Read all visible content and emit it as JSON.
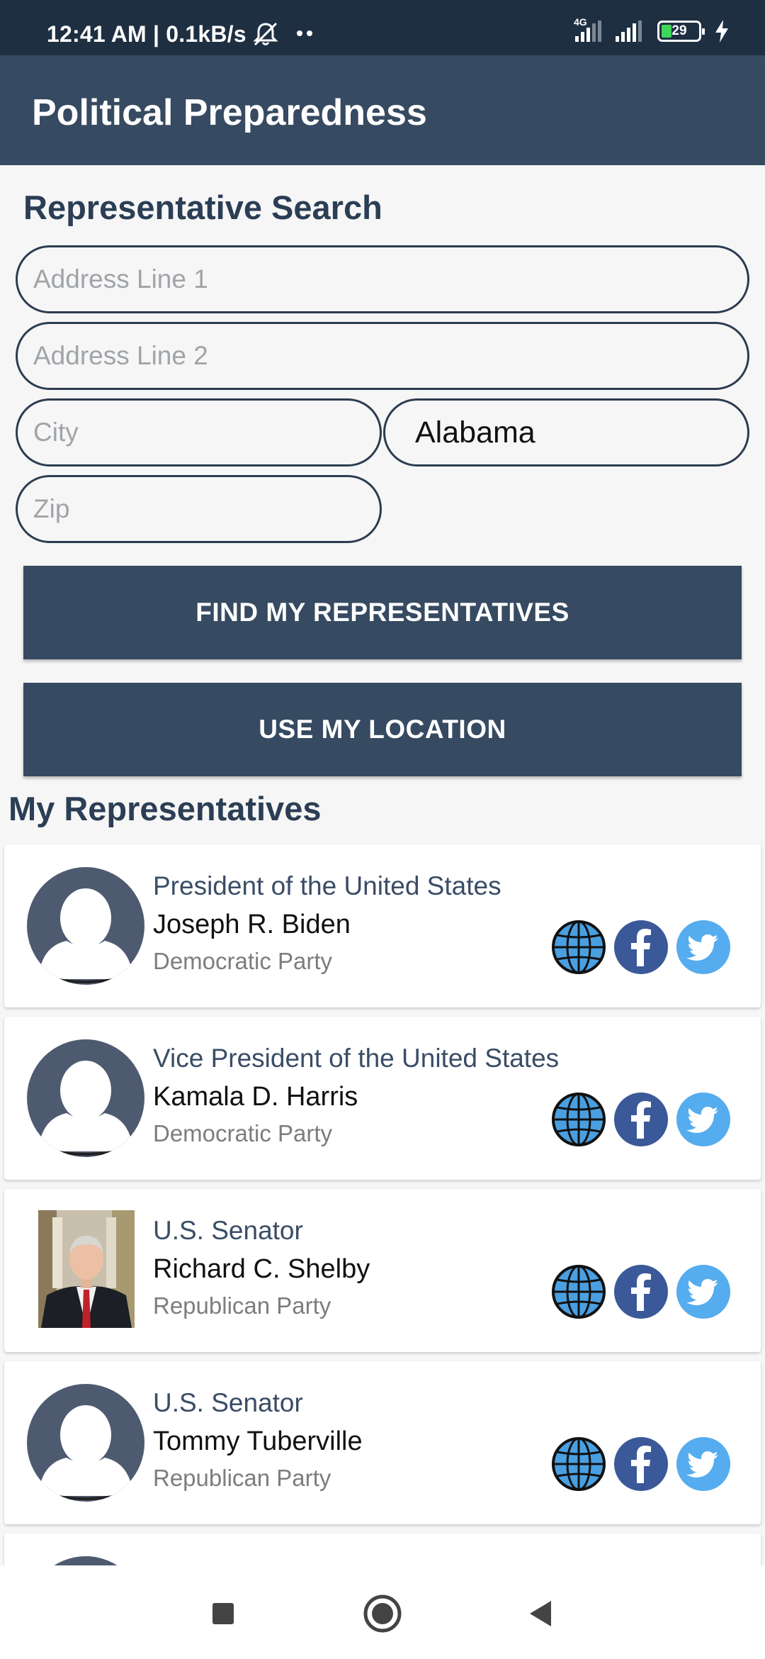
{
  "status_bar": {
    "time": "12:41 AM | 0.1kB/s",
    "network_label": "4G",
    "battery_percent": "29",
    "icons": [
      "mute-bell-icon",
      "more-dots-icon",
      "signal-icon",
      "signal-icon",
      "battery-icon",
      "charging-icon"
    ]
  },
  "app_bar": {
    "title": "Political Preparedness"
  },
  "search": {
    "title": "Representative Search",
    "address_line_1_placeholder": "Address Line 1",
    "address_line_2_placeholder": "Address Line 2",
    "city_placeholder": "City",
    "state_value": "Alabama",
    "zip_placeholder": "Zip",
    "find_button": "FIND MY REPRESENTATIVES",
    "location_button": "USE MY LOCATION"
  },
  "representatives": {
    "title": "My Representatives",
    "items": [
      {
        "office": "President of the United States",
        "name": "Joseph R. Biden",
        "party": "Democratic Party",
        "has_photo": false
      },
      {
        "office": "Vice President of the United States",
        "name": "Kamala D. Harris",
        "party": "Democratic Party",
        "has_photo": false
      },
      {
        "office": "U.S. Senator",
        "name": "Richard C. Shelby",
        "party": "Republican Party",
        "has_photo": true
      },
      {
        "office": "U.S. Senator",
        "name": "Tommy Tuberville",
        "party": "Republican Party",
        "has_photo": false
      }
    ],
    "link_icons": [
      "globe-icon",
      "facebook-icon",
      "twitter-icon"
    ]
  },
  "colors": {
    "primary": "#364a61",
    "status_bar": "#1f2f42",
    "facebook": "#3b5998",
    "twitter": "#55acee",
    "globe": "#4a9fe0"
  },
  "nav_bar": {
    "icons": [
      "recents-square-icon",
      "home-circle-icon",
      "back-triangle-icon"
    ]
  }
}
